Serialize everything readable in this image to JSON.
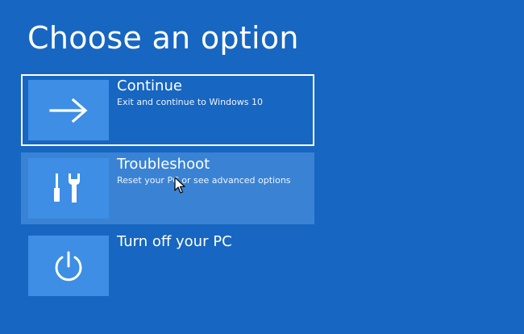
{
  "page": {
    "title": "Choose an option"
  },
  "options": [
    {
      "title": "Continue",
      "description": "Exit and continue to Windows 10",
      "icon": "arrow-right-icon",
      "state": "selected"
    },
    {
      "title": "Troubleshoot",
      "description": "Reset your PC or see advanced options",
      "icon": "tools-icon",
      "state": "hovered"
    },
    {
      "title": "Turn off your PC",
      "description": "",
      "icon": "power-icon",
      "state": "normal"
    }
  ],
  "colors": {
    "background": "#1766c1",
    "tile": "#3d8ee4",
    "hover": "#3a83d4",
    "text": "#ffffff"
  }
}
